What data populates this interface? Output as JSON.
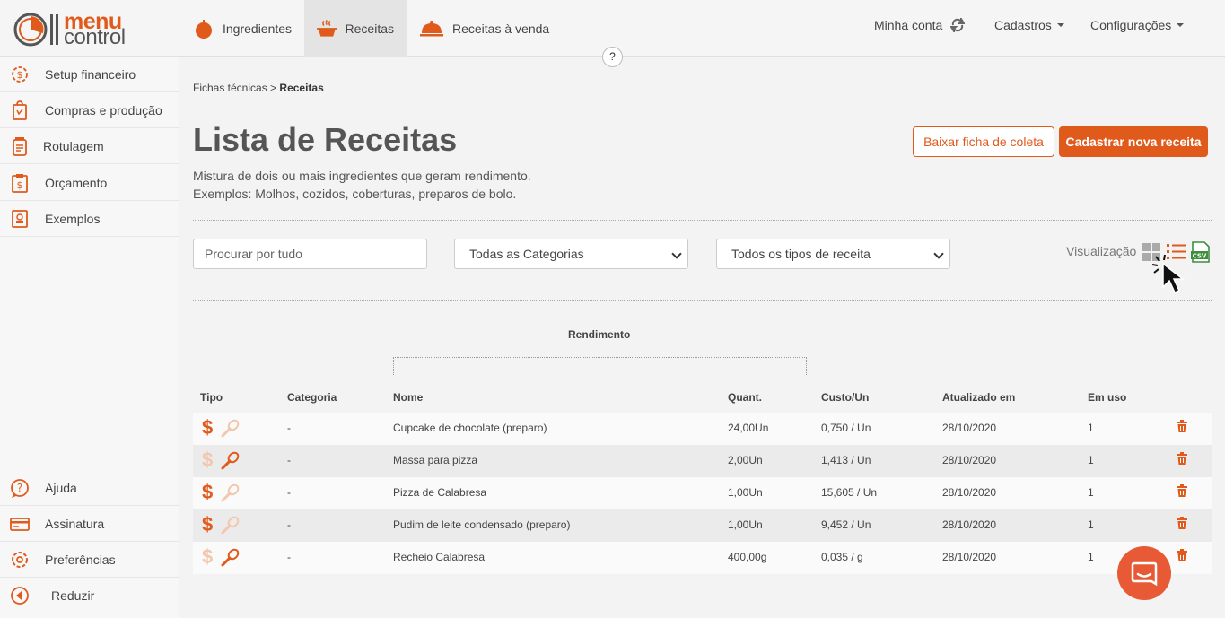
{
  "brand": {
    "word1": "menu",
    "word2": "control"
  },
  "nav": {
    "tabs": [
      {
        "label": "Ingredientes",
        "icon": "tomato-icon"
      },
      {
        "label": "Receitas",
        "icon": "pot-icon",
        "active": true
      },
      {
        "label": "Receitas à venda",
        "icon": "cloche-icon"
      }
    ],
    "right": {
      "account": "Minha conta",
      "cadastros": "Cadastros",
      "config": "Configurações"
    },
    "help": "?"
  },
  "sidebar": {
    "top": [
      {
        "label": "Setup financeiro",
        "icon": "gear-dollar-icon"
      },
      {
        "label": "Compras e produção",
        "icon": "shopping-bag-icon"
      },
      {
        "label": "Rotulagem",
        "icon": "label-jar-icon"
      },
      {
        "label": "Orçamento",
        "icon": "clipboard-dollar-icon"
      },
      {
        "label": "Exemplos",
        "icon": "recipe-book-icon"
      }
    ],
    "bottom": [
      {
        "label": "Ajuda",
        "icon": "help-bubble-icon"
      },
      {
        "label": "Assinatura",
        "icon": "card-icon"
      },
      {
        "label": "Preferências",
        "icon": "gear-icon"
      },
      {
        "label": "Reduzir",
        "icon": "collapse-icon"
      }
    ]
  },
  "breadcrumb": {
    "parent": "Fichas técnicas",
    "sep": ">",
    "current": "Receitas"
  },
  "page": {
    "title": "Lista de Receitas",
    "subtitle1": "Mistura de dois ou mais ingredientes que geram rendimento.",
    "subtitle2": "Exemplos: Molhos, cozidos, coberturas, preparos de bolo.",
    "btn_download": "Baixar ficha de coleta",
    "btn_new": "Cadastrar nova receita"
  },
  "filters": {
    "search_placeholder": "Procurar por tudo",
    "category": "Todas as Categorias",
    "type": "Todos os tipos de receita",
    "viz_label": "Visualização"
  },
  "table": {
    "group_label": "Rendimento",
    "headers": {
      "tipo": "Tipo",
      "categoria": "Categoria",
      "nome": "Nome",
      "quant": "Quant.",
      "custo": "Custo/Un",
      "atualizado": "Atualizado em",
      "emuso": "Em uso"
    },
    "rows": [
      {
        "for_sale": true,
        "is_prep": false,
        "categoria": "-",
        "nome": "Cupcake de chocolate (preparo)",
        "quant": "24,00Un",
        "custo": "0,750 / Un",
        "atualizado": "28/10/2020",
        "emuso": "1"
      },
      {
        "for_sale": false,
        "is_prep": true,
        "categoria": "-",
        "nome": "Massa para pizza",
        "quant": "2,00Un",
        "custo": "1,413 / Un",
        "atualizado": "28/10/2020",
        "emuso": "1"
      },
      {
        "for_sale": true,
        "is_prep": false,
        "categoria": "-",
        "nome": "Pizza de Calabresa",
        "quant": "1,00Un",
        "custo": "15,605 / Un",
        "atualizado": "28/10/2020",
        "emuso": "1"
      },
      {
        "for_sale": true,
        "is_prep": false,
        "categoria": "-",
        "nome": "Pudim de leite condensado (preparo)",
        "quant": "1,00Un",
        "custo": "9,452 / Un",
        "atualizado": "28/10/2020",
        "emuso": "1"
      },
      {
        "for_sale": false,
        "is_prep": true,
        "categoria": "-",
        "nome": "Recheio Calabresa",
        "quant": "400,00g",
        "custo": "0,035 / g",
        "atualizado": "28/10/2020",
        "emuso": "1"
      }
    ]
  },
  "colors": {
    "accent": "#e05a1b",
    "faded": "#f2c7b0",
    "csv_green": "#3e8e3e"
  }
}
